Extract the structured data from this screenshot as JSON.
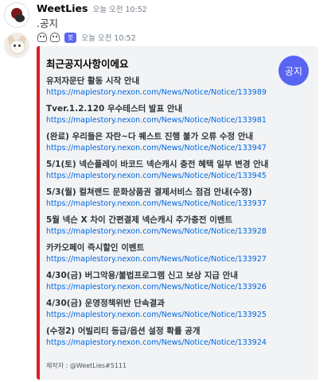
{
  "messages": [
    {
      "username": "WeetLies",
      "timestamp": "오늘 오전 10:52",
      "content": ".공지"
    }
  ],
  "bot_message": {
    "bot_tag": "봇",
    "timestamp": "오늘 오전 10:52",
    "embed": {
      "title": "최근공지사항이에요",
      "thumbnail_text": "공지",
      "accent_color": "#e01e24",
      "items": [
        {
          "title": "유저자문단 활동 시작 안내",
          "link": "https://maplestory.nexon.com/News/Notice/Notice/133989"
        },
        {
          "title": "Tver.1.2.120 우수테스터 발표 안내",
          "link": "https://maplestory.nexon.com/News/Notice/Notice/133981"
        },
        {
          "title": "(완료) 우리들은 자란~다 퀘스트 진행 불가 오류 수정 안내",
          "link": "https://maplestory.nexon.com/News/Notice/Notice/133947"
        },
        {
          "title": "5/1(토) 넥슨플레이 바코드 넥슨캐시 충전 혜택 일부 변경 안내",
          "link": "https://maplestory.nexon.com/News/Notice/Notice/133945"
        },
        {
          "title": "5/3(월) 컬쳐랜드 문화상품권 결제서비스 점검 안내(수정)",
          "link": "https://maplestory.nexon.com/News/Notice/Notice/133937"
        },
        {
          "title": "5월 넥슨 X 차이 간편결제 넥슨캐시 추가충전 이벤트",
          "link": "https://maplestory.nexon.com/News/Notice/Notice/133928"
        },
        {
          "title": "카카오페이 즉시할인 이벤트",
          "link": "https://maplestory.nexon.com/News/Notice/Notice/133927"
        },
        {
          "title": "4/30(금) 버그악용/불법프로그램 신고 보상 지급 안내",
          "link": "https://maplestory.nexon.com/News/Notice/Notice/133926"
        },
        {
          "title": "4/30(금) 운영정책위반 단속결과",
          "link": "https://maplestory.nexon.com/News/Notice/Notice/133925"
        },
        {
          "title": "(수정2) 어빌리티 등급/옵션 설정 확률 공개",
          "link": "https://maplestory.nexon.com/News/Notice/Notice/133924"
        }
      ],
      "footer": "제작자 : @WeetLies#5111"
    }
  }
}
